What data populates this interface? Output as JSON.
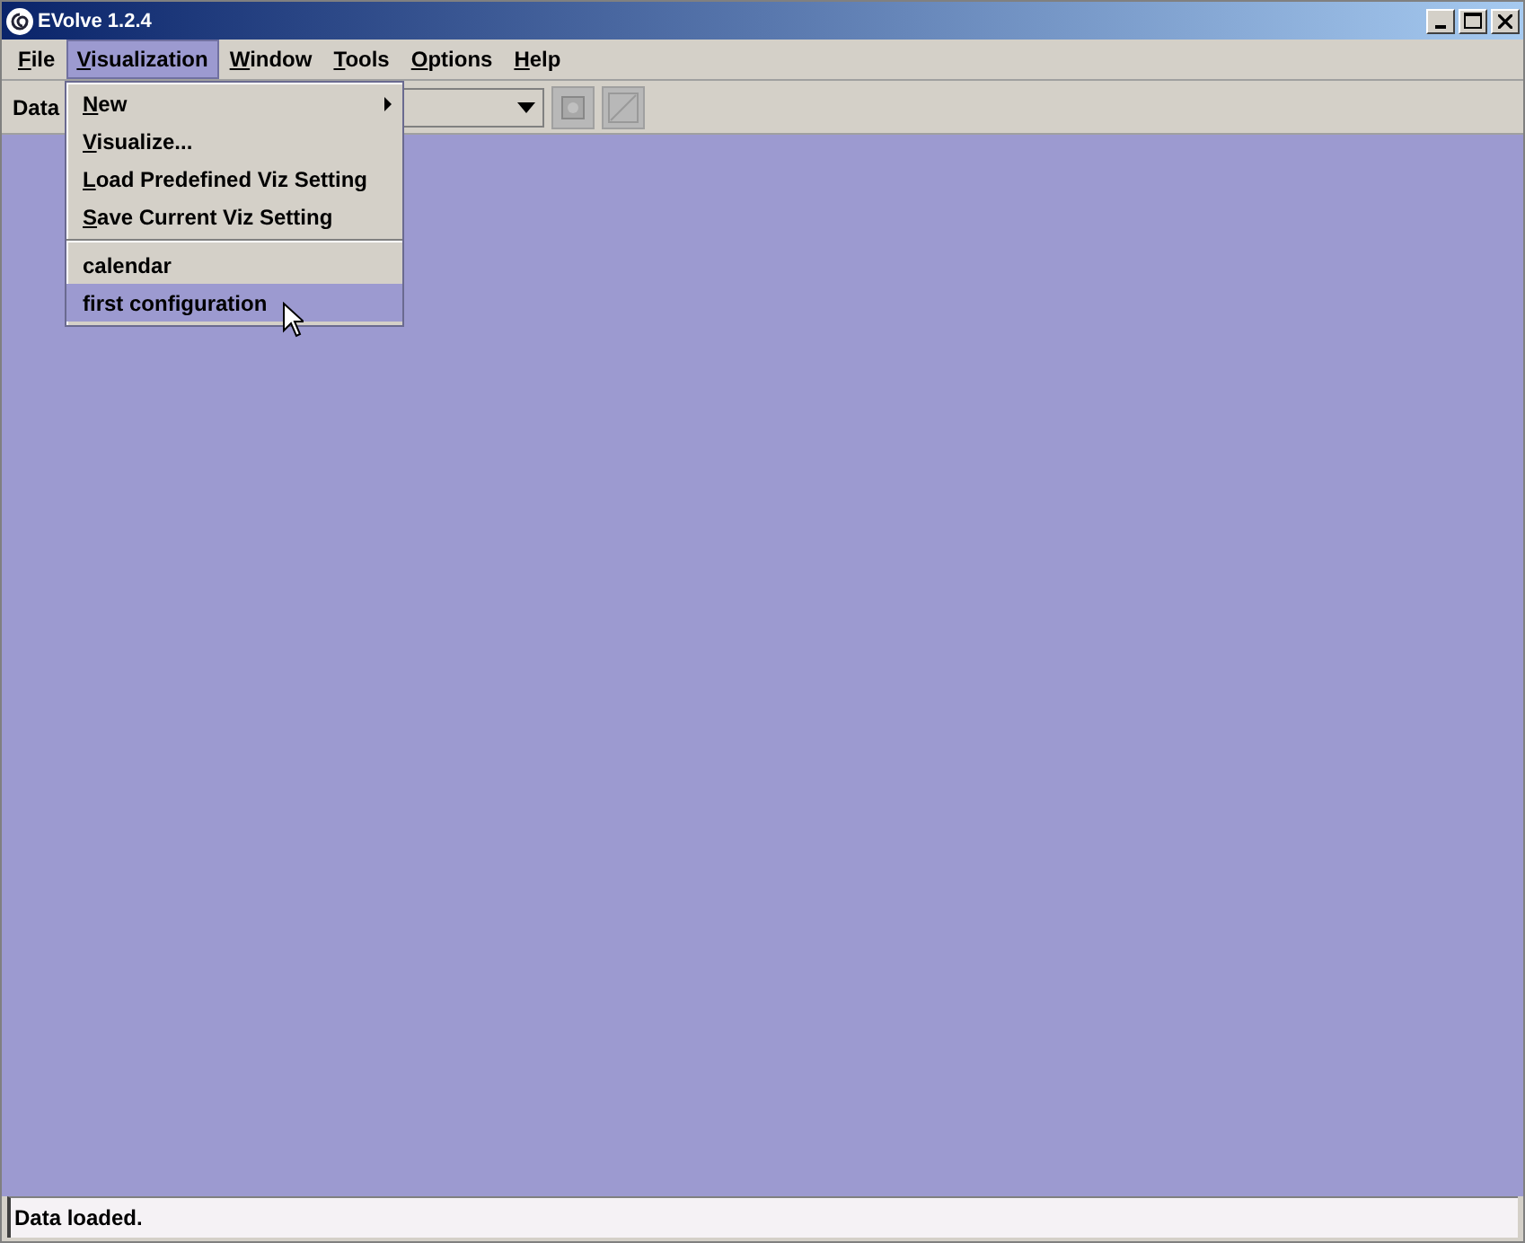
{
  "window": {
    "title": "EVolve 1.2.4",
    "controls": [
      {
        "kind": "minimize"
      },
      {
        "kind": "maximize"
      },
      {
        "kind": "close"
      }
    ]
  },
  "menubar": [
    {
      "label": "File",
      "selected": false
    },
    {
      "label": "Visualization",
      "selected": true
    },
    {
      "label": "Window",
      "selected": false
    },
    {
      "label": "Tools",
      "selected": false
    },
    {
      "label": "Options",
      "selected": false
    },
    {
      "label": "Help",
      "selected": false
    }
  ],
  "toolbar": {
    "label": "Data",
    "buttons": [
      {
        "disabled": true
      },
      {
        "disabled": true
      }
    ]
  },
  "menu": {
    "items": [
      {
        "label": "New",
        "kind": "submenu",
        "mnemonic": true,
        "selected": false
      },
      {
        "label": "Visualize...",
        "kind": "item",
        "mnemonic": true,
        "selected": false
      },
      {
        "label": "Load Predefined Viz Setting",
        "kind": "item",
        "mnemonic": true,
        "selected": false
      },
      {
        "label": "Save Current Viz Setting",
        "kind": "item",
        "mnemonic": true,
        "selected": false
      },
      {
        "kind": "separator"
      },
      {
        "label": "calendar",
        "kind": "item",
        "mnemonic": false,
        "selected": false
      },
      {
        "label": "first configuration",
        "kind": "item",
        "mnemonic": false,
        "selected": true
      }
    ]
  },
  "status_bar": {
    "text": "Data loaded."
  }
}
